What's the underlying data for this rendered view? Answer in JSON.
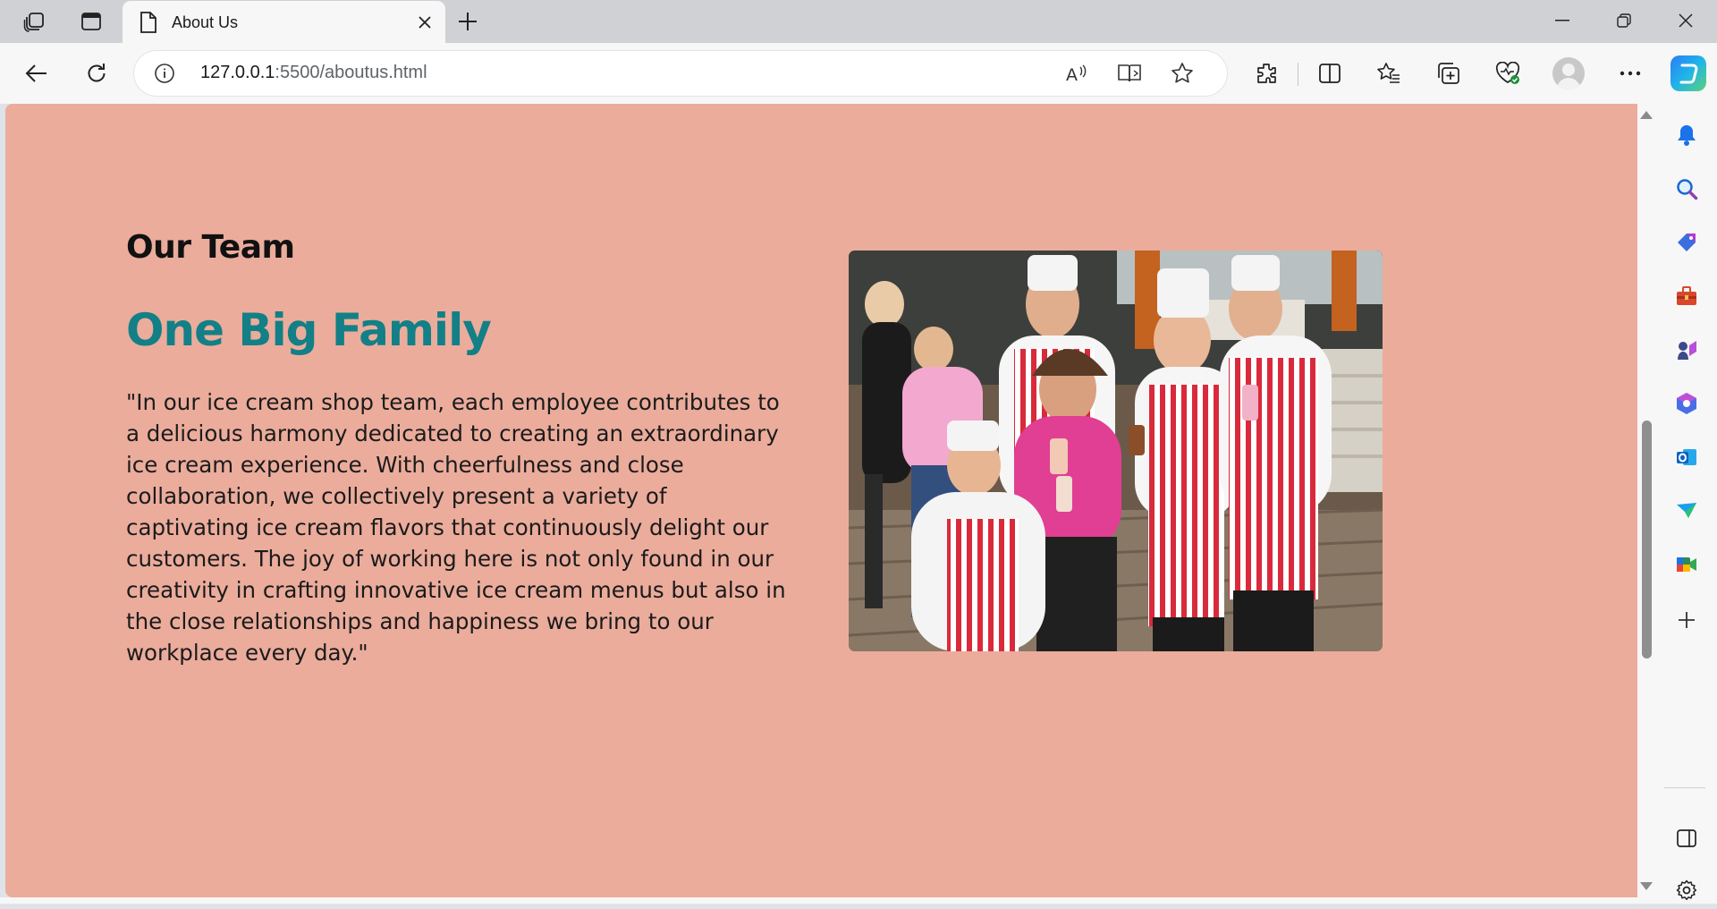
{
  "browser": {
    "tab": {
      "title": "About Us"
    },
    "address": {
      "host": "127.0.0.1",
      "path": ":5500/aboutus.html"
    }
  },
  "page": {
    "section_label": "Our Team",
    "headline": "One Big Family",
    "quote": "\"In our ice cream shop team, each employee contributes to a delicious harmony dedicated to creating an extraordinary ice cream experience. With cheerfulness and close collaboration, we collectively present a variety of captivating ice cream flavors that continuously delight our customers. The joy of working here is not only found in our creativity in crafting innovative ice cream menus but also in the close relationships and happiness we bring to our workplace every day.\"",
    "colors": {
      "background": "#ebac9c",
      "headline": "#128086",
      "text": "#111111"
    }
  },
  "icons": {
    "tabstrip": [
      "workspaces-icon",
      "tab-actions-icon",
      "page-favicon-icon",
      "close-icon",
      "plus-icon",
      "minimize-icon",
      "restore-icon",
      "window-close-icon"
    ],
    "toolbar": [
      "back-icon",
      "refresh-icon",
      "info-icon",
      "read-aloud-icon",
      "immersive-reader-icon",
      "favorite-star-icon",
      "extensions-icon",
      "split-screen-icon",
      "favorites-icon",
      "collections-icon",
      "browser-essentials-icon",
      "profile-icon",
      "more-icon",
      "copilot-icon"
    ],
    "sidebar": [
      "notifications-icon",
      "search-icon",
      "shopping-icon",
      "tools-icon",
      "games-icon",
      "microsoft365-icon",
      "outlook-icon",
      "drop-icon",
      "meet-icon",
      "add-icon",
      "sidebar-toggle-icon",
      "settings-icon"
    ]
  }
}
